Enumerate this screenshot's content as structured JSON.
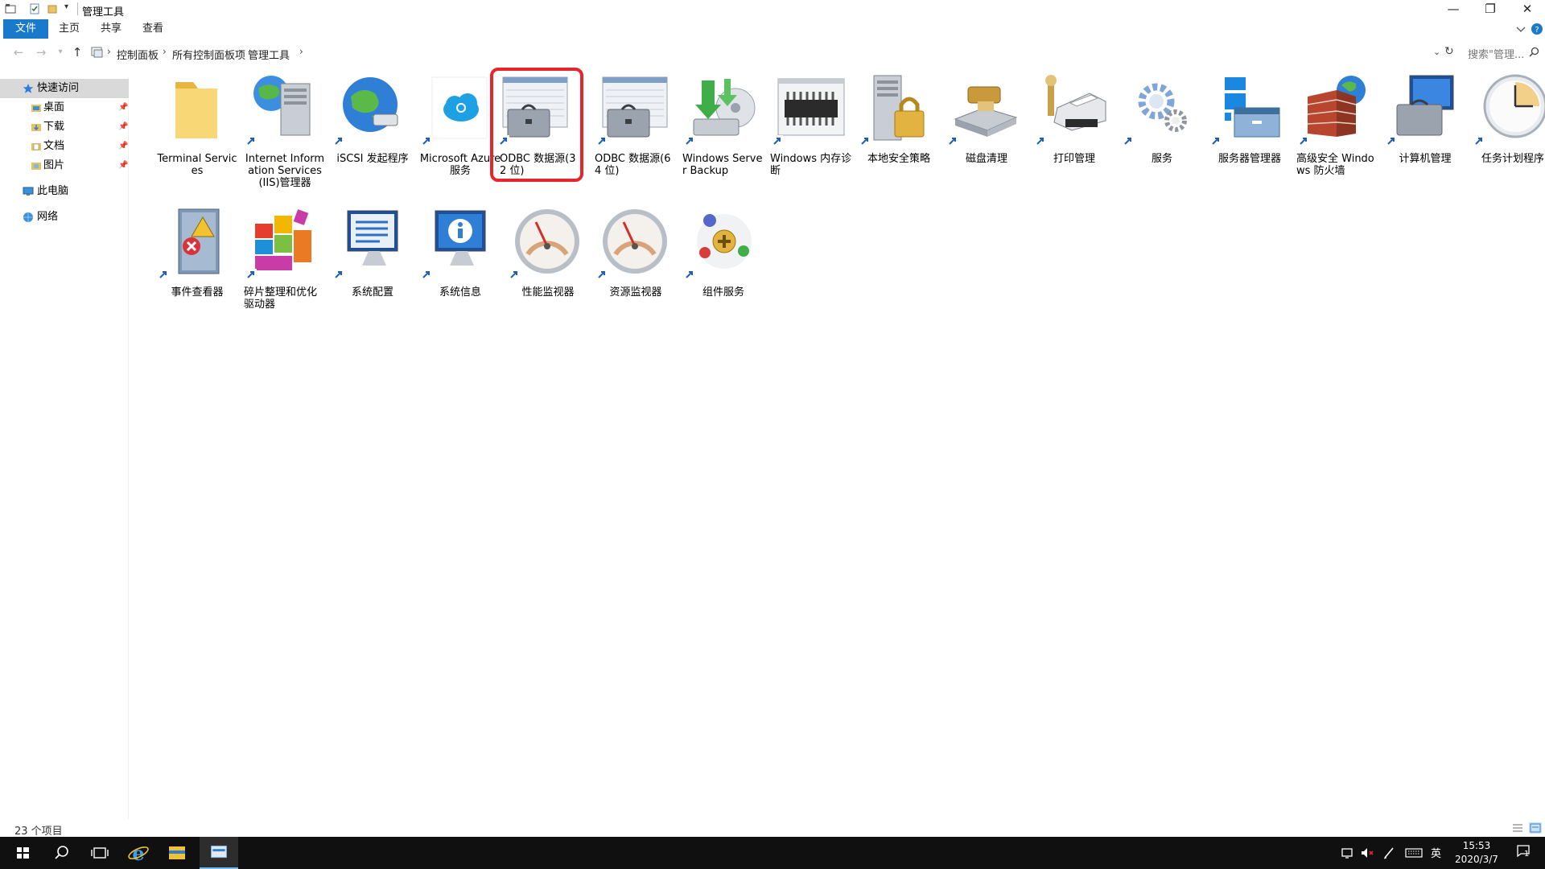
{
  "window": {
    "title": "管理工具"
  },
  "ribbon": {
    "tabs": [
      "文件",
      "主页",
      "共享",
      "查看"
    ]
  },
  "address": {
    "breadcrumbs": [
      "控制面板",
      "所有控制面板项",
      "管理工具"
    ],
    "search_placeholder": "搜索\"管理..."
  },
  "navpane": {
    "quick_access": "快速访问",
    "pinned": [
      "桌面",
      "下载",
      "文档",
      "图片"
    ],
    "this_pc": "此电脑",
    "network": "网络"
  },
  "items": [
    {
      "label": "Terminal Services",
      "icon": "folder-icon"
    },
    {
      "label": "Internet Information Services (IIS)管理器",
      "icon": "iis-server-icon"
    },
    {
      "label": "iSCSI 发起程序",
      "icon": "globe-network-icon"
    },
    {
      "label": "Microsoft Azure 服务",
      "icon": "azure-cloud-icon"
    },
    {
      "label": "ODBC 数据源(32 位)",
      "icon": "odbc-toolbox-icon",
      "highlighted": true
    },
    {
      "label": "ODBC 数据源(64 位)",
      "icon": "odbc-toolbox-icon"
    },
    {
      "label": "Windows Server Backup",
      "icon": "backup-drive-icon"
    },
    {
      "label": "Windows 内存诊断",
      "icon": "memory-chip-icon"
    },
    {
      "label": "本地安全策略",
      "icon": "server-lock-icon"
    },
    {
      "label": "磁盘清理",
      "icon": "disk-brush-icon"
    },
    {
      "label": "打印管理",
      "icon": "printer-icon"
    },
    {
      "label": "服务",
      "icon": "gears-icon"
    },
    {
      "label": "服务器管理器",
      "icon": "server-manager-icon"
    },
    {
      "label": "高级安全 Windows 防火墙",
      "icon": "firewall-icon"
    },
    {
      "label": "计算机管理",
      "icon": "computer-management-icon"
    },
    {
      "label": "任务计划程序",
      "icon": "clock-icon"
    },
    {
      "label": "事件查看器",
      "icon": "event-viewer-icon"
    },
    {
      "label": "碎片整理和优化驱动器",
      "icon": "defrag-blocks-icon"
    },
    {
      "label": "系统配置",
      "icon": "system-config-icon"
    },
    {
      "label": "系统信息",
      "icon": "system-info-icon"
    },
    {
      "label": "性能监视器",
      "icon": "gauge-icon"
    },
    {
      "label": "资源监视器",
      "icon": "gauge-icon"
    },
    {
      "label": "组件服务",
      "icon": "component-services-icon"
    }
  ],
  "status": {
    "item_count": "23 个项目"
  },
  "taskbar": {
    "ime": "英",
    "time": "15:53",
    "date": "2020/3/7",
    "notifications": "1"
  },
  "colors": {
    "accent": "#1979ca",
    "highlight_box": "#e8252d",
    "taskbar_bg": "#101010"
  }
}
